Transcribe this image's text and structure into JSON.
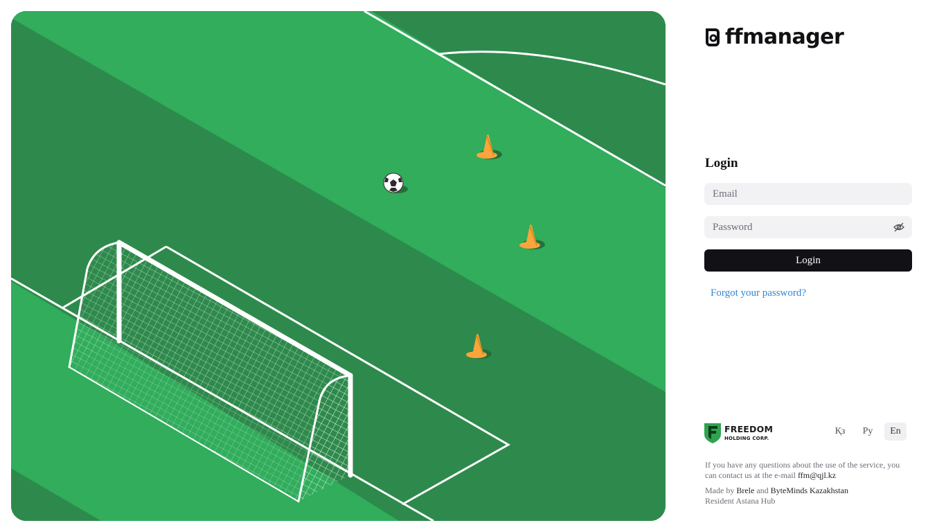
{
  "brand": {
    "name": "ffmanager"
  },
  "login": {
    "title": "Login",
    "email_placeholder": "Email",
    "password_placeholder": "Password",
    "button_label": "Login",
    "forgot_label": "Forgot your password?"
  },
  "sponsor": {
    "line1": "FREEDOM",
    "line2": "HOLDING CORP."
  },
  "languages": [
    {
      "label": "Қз",
      "active": false
    },
    {
      "label": "Ру",
      "active": false
    },
    {
      "label": "En",
      "active": true
    }
  ],
  "footer": {
    "contact_text": "If you have any questions about the use of the service, you can contact us at the e-mail ",
    "contact_email": "ffm@qjl.kz",
    "made_by_prefix": "Made by ",
    "made_by_1": "Brele",
    "and": " and ",
    "made_by_2": "ByteMinds Kazakhstan",
    "resident": "Resident Astana Hub"
  },
  "colors": {
    "pitch_dark": "#2e8a4c",
    "pitch_light": "#31ad5c",
    "cone": "#f9a53b",
    "button": "#121216",
    "link": "#2f86d8",
    "freedom_green": "#2ea44f"
  },
  "icons": [
    "eye-off-icon",
    "soccer-ball-icon",
    "traffic-cone-icon",
    "football-goal-icon",
    "ffmanager-logo-icon",
    "freedom-logo-icon"
  ]
}
